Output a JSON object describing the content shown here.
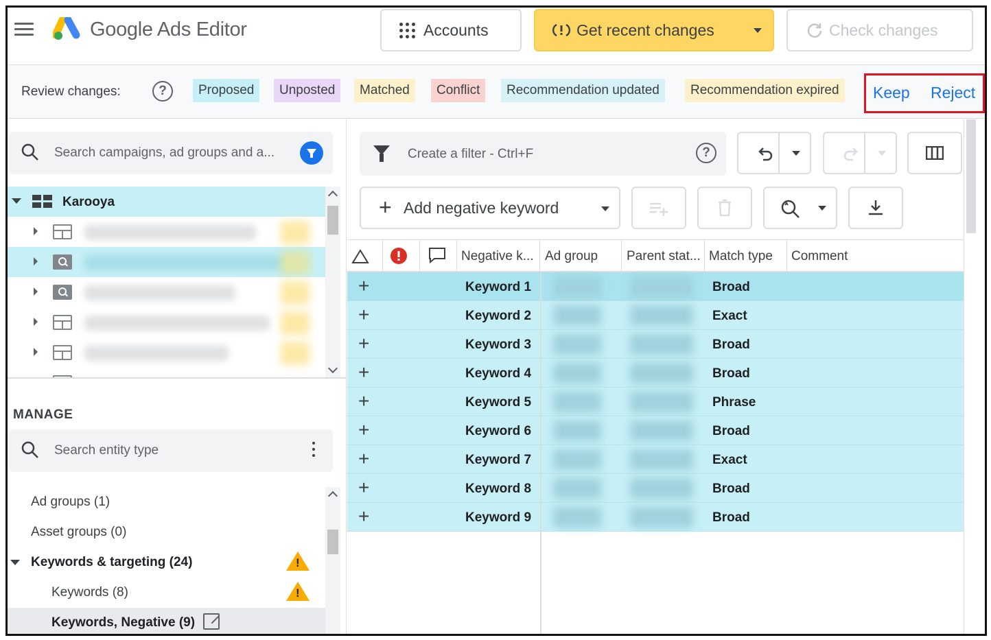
{
  "header": {
    "app_title": "Google Ads Editor",
    "accounts_label": "Accounts",
    "recent_changes_label": "Get recent changes",
    "check_changes_label": "Check changes",
    "brand_colors": {
      "blue": "#4285f4",
      "yellow": "#fbbc04",
      "green": "#34a853",
      "accent": "#fdd663"
    }
  },
  "review": {
    "label": "Review changes:",
    "help_glyph": "?",
    "chips": {
      "proposed": "Proposed",
      "unposted": "Unposted",
      "matched": "Matched",
      "conflict": "Conflict",
      "recommendation_updated": "Recommendation updated",
      "recommendation_expired": "Recommendation expired"
    },
    "keep_label": "Keep",
    "reject_label": "Reject"
  },
  "left": {
    "search_placeholder": "Search campaigns, ad groups and a...",
    "account_name": "Karooya",
    "manage_title": "MANAGE",
    "entity_search_placeholder": "Search entity type",
    "entities": [
      {
        "label": "Ad groups (1)"
      },
      {
        "label": "Asset groups (0)"
      },
      {
        "label": "Keywords & targeting (24)"
      },
      {
        "label": "Keywords (8)"
      },
      {
        "label": "Keywords, Negative (9)"
      }
    ]
  },
  "right": {
    "filter_placeholder": "Create a filter - Ctrl+F",
    "filter_help_glyph": "?",
    "add_negative_label": "Add negative keyword",
    "add_plus_glyph": "+",
    "columns": {
      "negative_keyword": "Negative k...",
      "ad_group": "Ad group",
      "parent_status": "Parent stat...",
      "match_type": "Match type",
      "comment": "Comment"
    },
    "row_add_glyph": "+",
    "rows": [
      {
        "keyword": "Keyword 1",
        "match": "Broad"
      },
      {
        "keyword": "Keyword 2",
        "match": "Exact"
      },
      {
        "keyword": "Keyword 3",
        "match": "Broad"
      },
      {
        "keyword": "Keyword 4",
        "match": "Broad"
      },
      {
        "keyword": "Keyword 5",
        "match": "Phrase"
      },
      {
        "keyword": "Keyword 6",
        "match": "Broad"
      },
      {
        "keyword": "Keyword 7",
        "match": "Exact"
      },
      {
        "keyword": "Keyword 8",
        "match": "Broad"
      },
      {
        "keyword": "Keyword 9",
        "match": "Broad"
      }
    ]
  }
}
